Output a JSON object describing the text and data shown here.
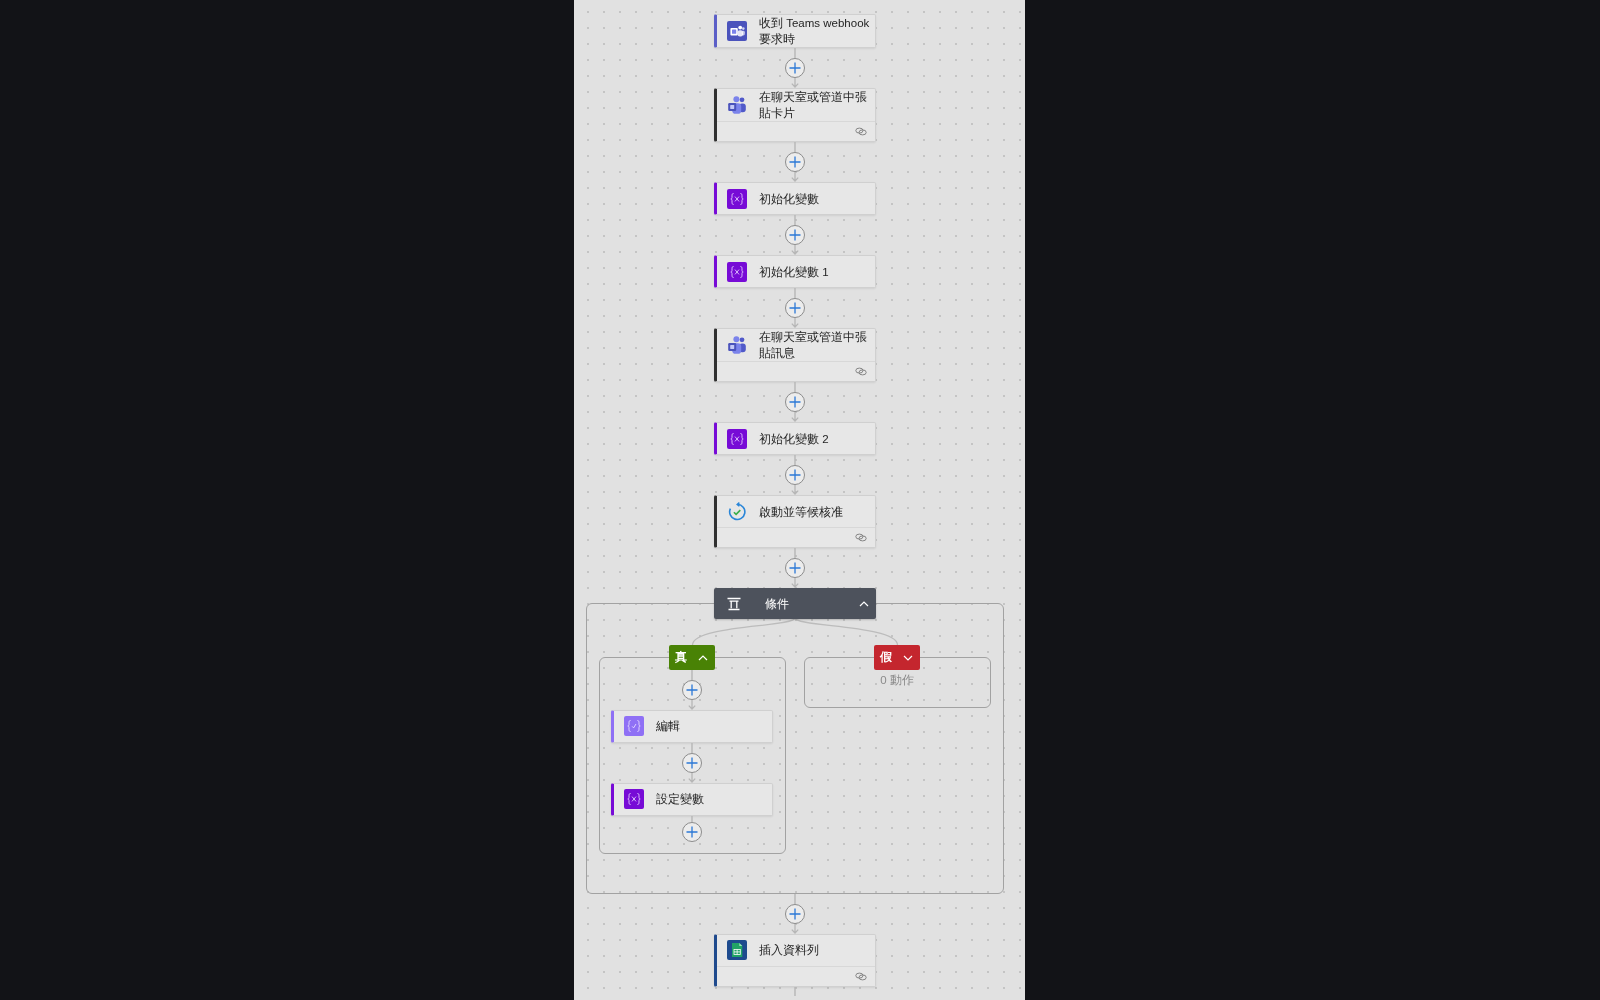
{
  "flow": {
    "steps": [
      {
        "kind": "webhook",
        "title": "收到 Teams webhook 要求時",
        "connection": false
      },
      {
        "kind": "teams",
        "title": "在聊天室或管道中張貼卡片",
        "connection": true
      },
      {
        "kind": "variable",
        "title": "初始化變數",
        "connection": false
      },
      {
        "kind": "variable",
        "title": "初始化變數 1",
        "connection": false
      },
      {
        "kind": "teams",
        "title": "在聊天室或管道中張貼訊息",
        "connection": true
      },
      {
        "kind": "variable",
        "title": "初始化變數 2",
        "connection": false
      },
      {
        "kind": "approval",
        "title": "啟動並等候核准",
        "connection": true
      },
      {
        "kind": "condition",
        "title": "條件",
        "expanded": true,
        "branches": [
          {
            "kind": "true",
            "label": "真",
            "expanded": true,
            "steps": [
              {
                "kind": "compose",
                "title": "編輯",
                "connection": false
              },
              {
                "kind": "variable",
                "title": "設定變數",
                "connection": false
              }
            ]
          },
          {
            "kind": "false",
            "label": "假",
            "expanded": false,
            "summary": "0 動作"
          }
        ]
      },
      {
        "kind": "sheet",
        "title": "插入資料列",
        "connection": true
      }
    ]
  }
}
